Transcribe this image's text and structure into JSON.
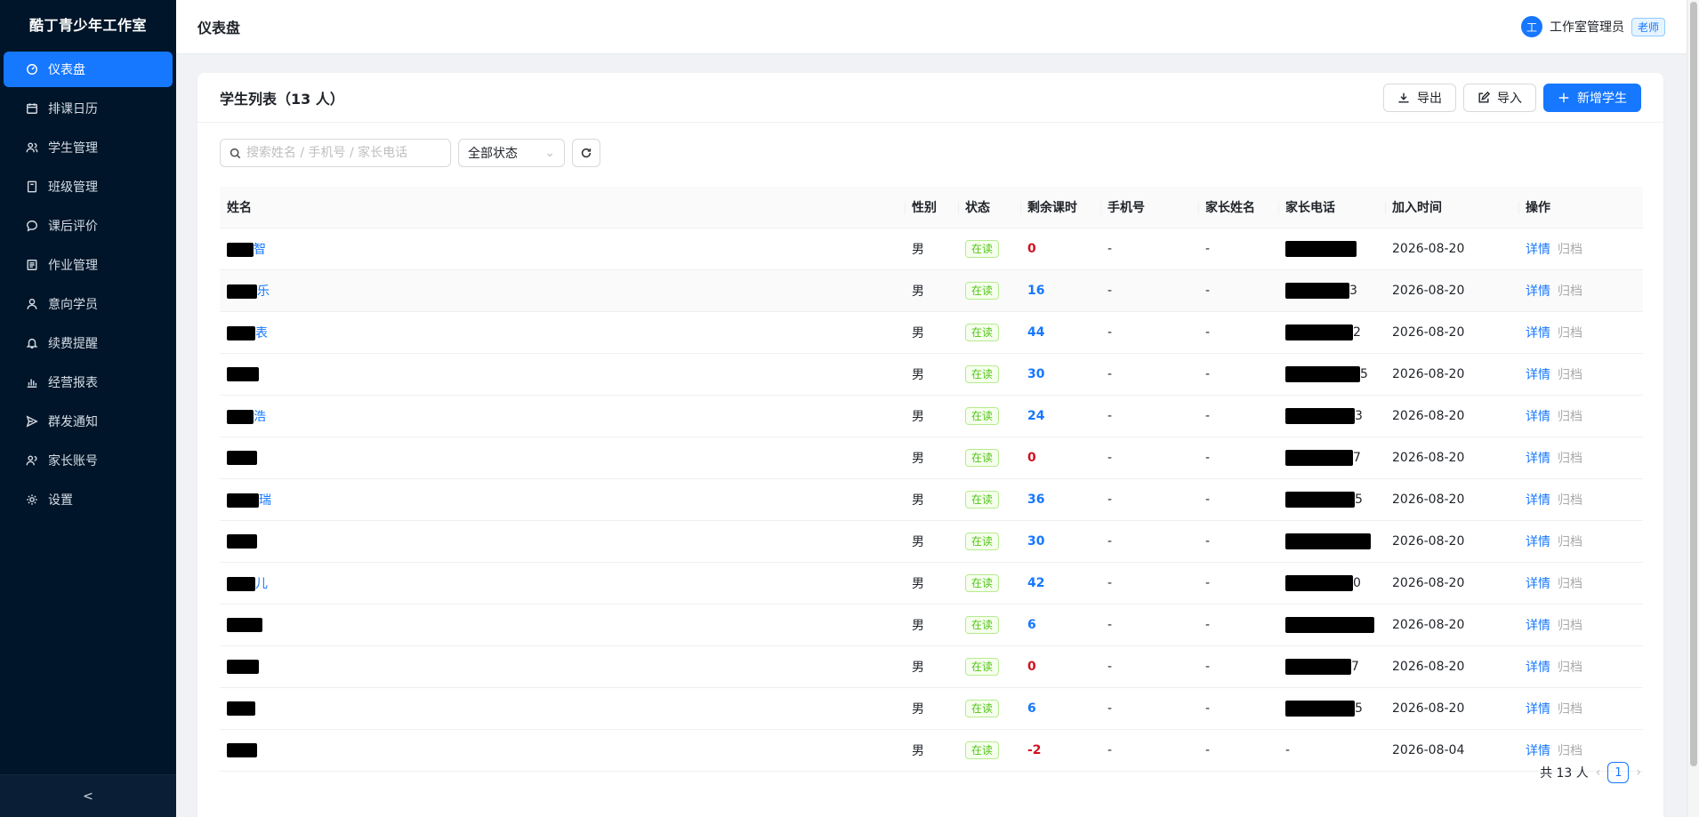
{
  "sidebar": {
    "brand": "酷丁青少年工作室",
    "items": [
      {
        "label": "仪表盘",
        "icon": "dashboard-icon"
      },
      {
        "label": "排课日历",
        "icon": "calendar-icon"
      },
      {
        "label": "学生管理",
        "icon": "users-icon"
      },
      {
        "label": "班级管理",
        "icon": "book-icon"
      },
      {
        "label": "课后评价",
        "icon": "chat-icon"
      },
      {
        "label": "作业管理",
        "icon": "list-icon"
      },
      {
        "label": "意向学员",
        "icon": "user-icon"
      },
      {
        "label": "续费提醒",
        "icon": "bell-icon"
      },
      {
        "label": "经营报表",
        "icon": "bar-chart-icon"
      },
      {
        "label": "群发通知",
        "icon": "send-icon"
      },
      {
        "label": "家长账号",
        "icon": "team-icon"
      },
      {
        "label": "设置",
        "icon": "gear-icon"
      }
    ],
    "active_index": 0,
    "collapse_glyph": "<"
  },
  "header": {
    "title": "仪表盘",
    "avatar_text": "工",
    "user_name": "工作室管理员",
    "role": "老师"
  },
  "card": {
    "title": "学生列表（13 人）",
    "export_label": "导出",
    "import_label": "导入",
    "add_label": "新增学生"
  },
  "filters": {
    "search_placeholder": "搜索姓名 / 手机号 / 家长电话",
    "status_value": "全部状态"
  },
  "table": {
    "columns": [
      "姓名",
      "性别",
      "状态",
      "剩余课时",
      "手机号",
      "家长姓名",
      "家长电话",
      "加入时间",
      "操作"
    ],
    "rows": [
      {
        "name_tail": "智",
        "gender": "男",
        "status": "在读",
        "hours": "0",
        "phone": "-",
        "parent_name": "-",
        "parent_phone_tail": "",
        "join": "2026-08-20"
      },
      {
        "name_tail": "乐",
        "gender": "男",
        "status": "在读",
        "hours": "16",
        "phone": "-",
        "parent_name": "-",
        "parent_phone_tail": "3",
        "join": "2026-08-20"
      },
      {
        "name_tail": "表",
        "gender": "男",
        "status": "在读",
        "hours": "44",
        "phone": "-",
        "parent_name": "-",
        "parent_phone_tail": "2",
        "join": "2026-08-20"
      },
      {
        "name_tail": "",
        "gender": "男",
        "status": "在读",
        "hours": "30",
        "phone": "-",
        "parent_name": "-",
        "parent_phone_tail": "5",
        "join": "2026-08-20"
      },
      {
        "name_tail": "浩",
        "gender": "男",
        "status": "在读",
        "hours": "24",
        "phone": "-",
        "parent_name": "-",
        "parent_phone_tail": "3",
        "join": "2026-08-20"
      },
      {
        "name_tail": "",
        "gender": "男",
        "status": "在读",
        "hours": "0",
        "phone": "-",
        "parent_name": "-",
        "parent_phone_tail": "7",
        "join": "2026-08-20"
      },
      {
        "name_tail": "瑞",
        "gender": "男",
        "status": "在读",
        "hours": "36",
        "phone": "-",
        "parent_name": "-",
        "parent_phone_tail": "5",
        "join": "2026-08-20"
      },
      {
        "name_tail": "",
        "gender": "男",
        "status": "在读",
        "hours": "30",
        "phone": "-",
        "parent_name": "-",
        "parent_phone_tail": "",
        "join": "2026-08-20"
      },
      {
        "name_tail": "儿",
        "gender": "男",
        "status": "在读",
        "hours": "42",
        "phone": "-",
        "parent_name": "-",
        "parent_phone_tail": "0",
        "join": "2026-08-20"
      },
      {
        "name_tail": "",
        "gender": "男",
        "status": "在读",
        "hours": "6",
        "phone": "-",
        "parent_name": "-",
        "parent_phone_tail": "",
        "join": "2026-08-20"
      },
      {
        "name_tail": "",
        "gender": "男",
        "status": "在读",
        "hours": "0",
        "phone": "-",
        "parent_name": "-",
        "parent_phone_tail": "7",
        "join": "2026-08-20"
      },
      {
        "name_tail": "",
        "gender": "男",
        "status": "在读",
        "hours": "6",
        "phone": "-",
        "parent_name": "-",
        "parent_phone_tail": "5",
        "join": "2026-08-20"
      },
      {
        "name_tail": "",
        "gender": "男",
        "status": "在读",
        "hours": "-2",
        "phone": "-",
        "parent_name": "-",
        "parent_phone_tail": "-",
        "join": "2026-08-04"
      }
    ],
    "detail_label": "详情",
    "archive_label": "归档"
  },
  "pagination": {
    "total_text": "共 13 人",
    "current_page": "1"
  },
  "colors": {
    "primary": "#1677ff",
    "sidebar_bg": "#001529",
    "danger": "#cf1322",
    "success": "#52c41a"
  }
}
